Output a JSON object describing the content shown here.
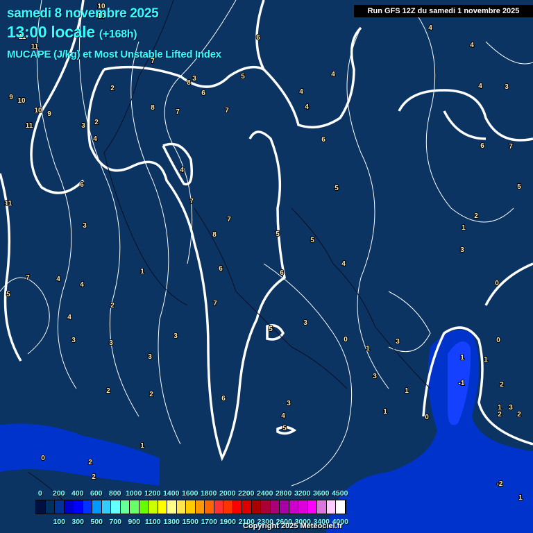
{
  "header": {
    "date": "samedi 8 novembre 2025",
    "time": "13:00 locale",
    "lead": "(+168h)",
    "product": "MUCAPE (J/kg) et Most Unstable Lifted Index",
    "run": "Run GFS 12Z du samedi 1 novembre 2025"
  },
  "legend": {
    "colors": [
      "#001040",
      "#00305e",
      "#003399",
      "#0000cc",
      "#0000ff",
      "#0033ff",
      "#0099ff",
      "#33ccff",
      "#66ffff",
      "#66ff99",
      "#66ff66",
      "#66ff00",
      "#ccff00",
      "#ffff00",
      "#ffff88",
      "#ffe64d",
      "#ffcc00",
      "#ff9900",
      "#ff6600",
      "#ff3333",
      "#ff3300",
      "#ff0000",
      "#dd0000",
      "#aa0000",
      "#aa0033",
      "#aa0077",
      "#aa00aa",
      "#cc00cc",
      "#dd00dd",
      "#ff00ff",
      "#dd77dd",
      "#ffccff",
      "#ffffff"
    ],
    "top_labels": [
      "0",
      "200",
      "400",
      "600",
      "800",
      "1000",
      "1200",
      "1400",
      "1600",
      "1800",
      "2000",
      "2200",
      "2400",
      "2800",
      "3200",
      "3600",
      "4500"
    ],
    "bottom_labels": [
      "100",
      "300",
      "500",
      "700",
      "900",
      "1100",
      "1300",
      "1500",
      "1700",
      "1900",
      "2100",
      "2300",
      "2600",
      "3000",
      "3400",
      "4000"
    ]
  },
  "contour_labels": [
    "10",
    "10",
    "11",
    "11",
    "6",
    "4",
    "4",
    "4",
    "8",
    "9",
    "10",
    "10",
    "9",
    "11",
    "2",
    "7",
    "3",
    "2",
    "4",
    "8",
    "7",
    "6",
    "5",
    "4",
    "4",
    "6",
    "4",
    "3",
    "7",
    "7",
    "6",
    "4",
    "6",
    "5",
    "7",
    "5",
    "11",
    "6",
    "3",
    "7",
    "8",
    "5",
    "1",
    "2",
    "3",
    "2",
    "6",
    "4",
    "4",
    "3",
    "7",
    "5",
    "3",
    "1",
    "3",
    "4",
    "4",
    "1",
    "2",
    "3",
    "3",
    "3",
    "2",
    "1",
    "3",
    "5",
    "6",
    "7",
    "0",
    "1",
    "2",
    "5",
    "3",
    "4",
    "5",
    "0",
    "2",
    "-1",
    "1",
    "0",
    "1",
    "0",
    "2",
    "1",
    "3",
    "-2",
    "1",
    "2",
    "3",
    "2",
    "0",
    "1"
  ],
  "footer": {
    "copyright": "Copyright 2025 Meteociel.fr"
  }
}
